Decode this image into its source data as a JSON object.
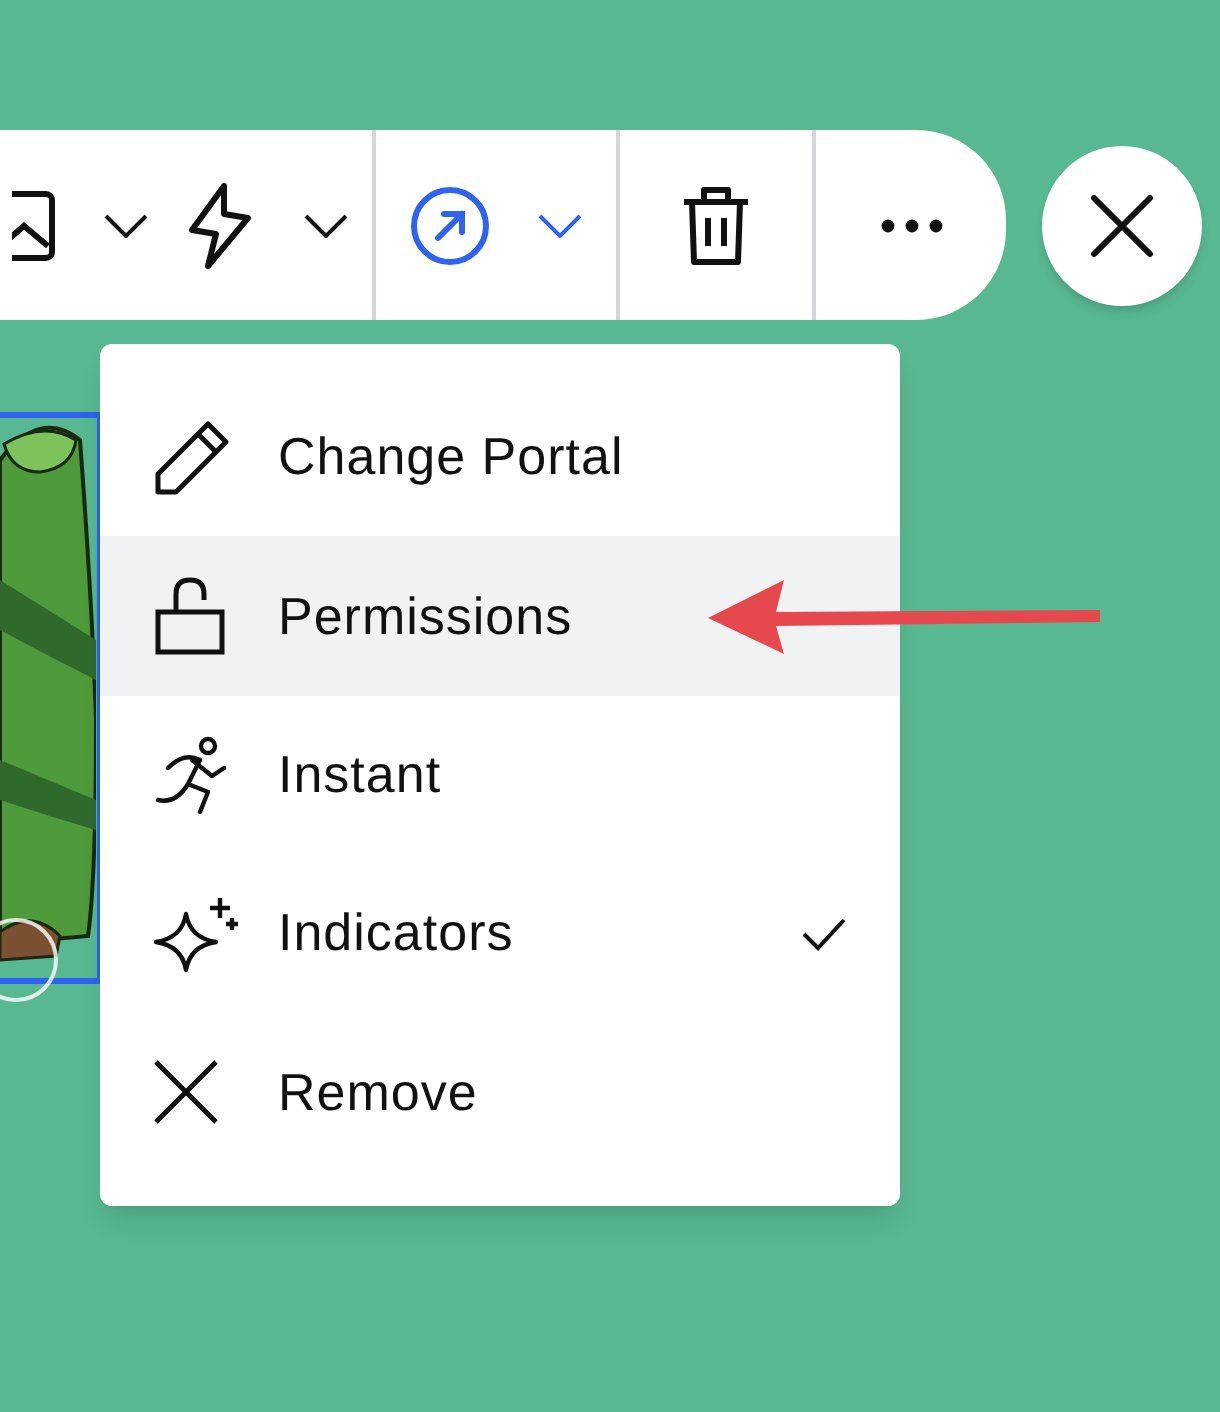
{
  "toolbar": {
    "buttons": [
      {
        "kind": "image",
        "selected": false,
        "dropdown": true
      },
      {
        "kind": "trigger",
        "selected": false,
        "dropdown": true
      },
      {
        "kind": "portal",
        "selected": true,
        "dropdown": true
      },
      {
        "kind": "delete",
        "selected": false,
        "dropdown": false
      },
      {
        "kind": "more",
        "selected": false,
        "dropdown": false
      }
    ]
  },
  "menu": {
    "items": [
      {
        "kind": "edit",
        "label": "Change Portal",
        "selected": false,
        "checked": false
      },
      {
        "kind": "lock",
        "label": "Permissions",
        "selected": true,
        "checked": false
      },
      {
        "kind": "run",
        "label": "Instant",
        "selected": false,
        "checked": false
      },
      {
        "kind": "sparkle",
        "label": "Indicators",
        "selected": false,
        "checked": true
      },
      {
        "kind": "remove",
        "label": "Remove",
        "selected": false,
        "checked": false
      }
    ]
  }
}
